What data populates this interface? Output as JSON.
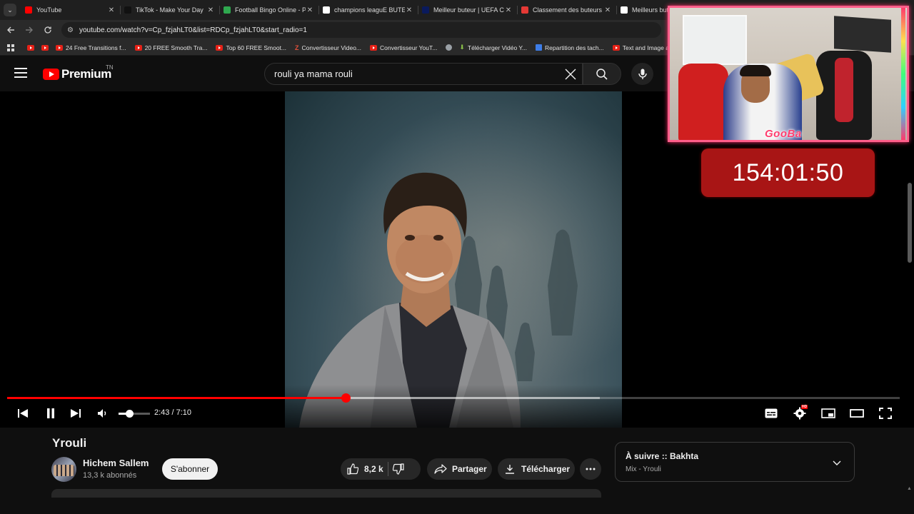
{
  "browser": {
    "tabs": [
      {
        "title": "YouTube",
        "favicon_color": "#ff0000",
        "active": true
      },
      {
        "title": "TikTok - Make Your Day",
        "favicon_color": "#111111"
      },
      {
        "title": "Football Bingo Online - P",
        "favicon_color": "#2fa84f"
      },
      {
        "title": "champions leaguE BUTEU",
        "favicon_color": "#ffffff"
      },
      {
        "title": "Meilleur buteur | UEFA Ch",
        "favicon_color": "#0a1a5c"
      },
      {
        "title": "Classement des buteurs L",
        "favicon_color": "#e53935"
      },
      {
        "title": "Meilleurs buteurs",
        "favicon_color": "#ffffff"
      }
    ],
    "url": "youtube.com/watch?v=Cp_fzjahLT0&list=RDCp_fzjahLT0&start_radio=1",
    "bookmarks": [
      {
        "label": "",
        "type": "yt"
      },
      {
        "label": "",
        "type": "yt"
      },
      {
        "label": "24 Free Transitions f...",
        "type": "yt"
      },
      {
        "label": "20 FREE Smooth Tra...",
        "type": "yt"
      },
      {
        "label": "Top 60 FREE Smoot...",
        "type": "yt"
      },
      {
        "label": "Convertisseur Video...",
        "type": "z"
      },
      {
        "label": "Convertisseur YouT...",
        "type": "yt"
      },
      {
        "label": "",
        "type": "globe"
      },
      {
        "label": "Télécharger Vidéo Y...",
        "type": "dl"
      },
      {
        "label": "Repartition des tach...",
        "type": "doc"
      },
      {
        "label": "Text and Image ani...",
        "type": "yt"
      }
    ]
  },
  "youtube": {
    "logo_text": "Premium",
    "country_code": "TN",
    "search_value": "rouli ya mama rouli"
  },
  "player": {
    "current_time": "2:43",
    "duration": "7:10",
    "time_display": "2:43 / 7:10",
    "progress_fraction": 0.379,
    "buffer_fraction": 0.664,
    "volume_fraction": 0.33,
    "accent": "#ff0000"
  },
  "overlay": {
    "brand": "GooBa",
    "timer": "154:01:50"
  },
  "video": {
    "title": "Yrouli",
    "channel": "Hichem Sallem",
    "subscribers": "13,3 k abonnés",
    "subscribe_label": "S'abonner",
    "likes": "8,2 k",
    "share_label": "Partager",
    "download_label": "Télécharger"
  },
  "up_next": {
    "title": "À suivre :: Bakhta",
    "subtitle": "Mix - Yrouli"
  }
}
